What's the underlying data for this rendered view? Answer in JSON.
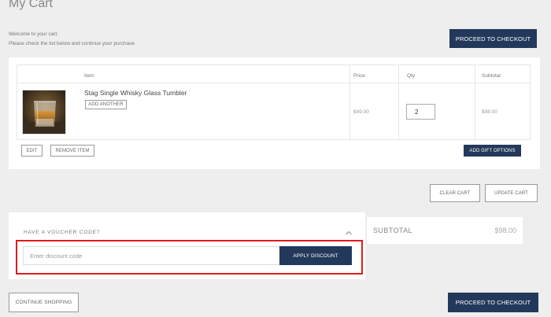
{
  "page": {
    "title": "My Cart",
    "welcome_line1": "Welcome to your cart.",
    "welcome_line2": "Please check the list below and continue your purchase",
    "proceed_label": "PROCEED TO CHECKOUT"
  },
  "table": {
    "headers": {
      "item": "Item",
      "price": "Price",
      "qty": "Qty",
      "subtotal": "Subtotal"
    }
  },
  "item": {
    "name": "Stag Single Whisky Glass Tumbler",
    "add_another_label": "ADD ANOTHER",
    "price": "$49.00",
    "qty": "2",
    "subtotal": "$98.00",
    "edit_label": "EDIT",
    "remove_label": "REMOVE ITEM",
    "gift_label": "ADD GIFT OPTIONS"
  },
  "cart_actions": {
    "clear_label": "CLEAR CART",
    "update_label": "UPDATE CART"
  },
  "voucher": {
    "heading": "HAVE A VOUCHER CODE?",
    "placeholder": "Enter discount code",
    "apply_label": "APPLY DISCOUNT"
  },
  "totals": {
    "subtotal_label": "SUBTOTAL",
    "subtotal_value": "$98.00"
  },
  "footer": {
    "continue_label": "CONTINUE SHOPPING",
    "proceed_label": "PROCEED TO CHECKOUT"
  },
  "colors": {
    "accent": "#23395b",
    "highlight": "#e21b1b"
  }
}
